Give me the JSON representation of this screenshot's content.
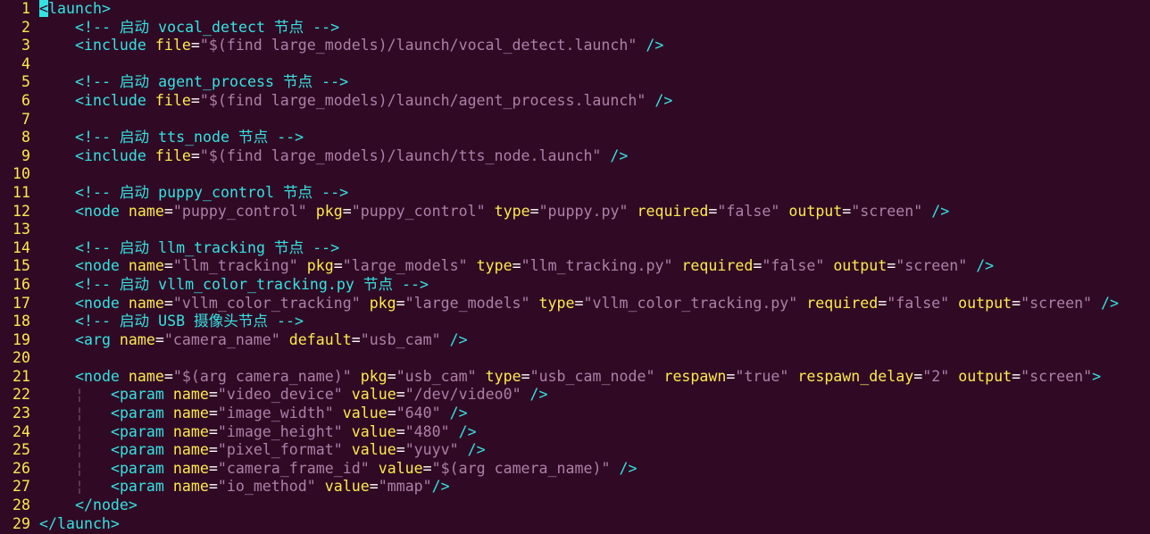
{
  "colors": {
    "background": "#300a24",
    "line_number": "#fce94f",
    "tag": "#34e2e2",
    "comment": "#34e2e2",
    "attribute": "#fce94f",
    "string": "#ad7fa8",
    "equals": "#ffffff",
    "cursor": "#34e2e2",
    "indent_guide": "#6a4a62"
  },
  "lines": [
    {
      "n": "1",
      "tokens": [
        {
          "t": "cursor",
          "v": "<"
        },
        {
          "t": "tag",
          "v": "launch>"
        }
      ]
    },
    {
      "n": "2",
      "tokens": [
        {
          "t": "ws",
          "v": "    "
        },
        {
          "t": "comment",
          "v": "<!-- 启动 vocal_detect 节点 -->"
        }
      ]
    },
    {
      "n": "3",
      "tokens": [
        {
          "t": "ws",
          "v": "    "
        },
        {
          "t": "tag",
          "v": "<include "
        },
        {
          "t": "attr",
          "v": "file"
        },
        {
          "t": "eq",
          "v": "="
        },
        {
          "t": "str",
          "v": "\"$(find large_models)/launch/vocal_detect.launch\""
        },
        {
          "t": "tag",
          "v": " />"
        }
      ]
    },
    {
      "n": "4",
      "tokens": []
    },
    {
      "n": "5",
      "tokens": [
        {
          "t": "ws",
          "v": "    "
        },
        {
          "t": "comment",
          "v": "<!-- 启动 agent_process 节点 -->"
        }
      ]
    },
    {
      "n": "6",
      "tokens": [
        {
          "t": "ws",
          "v": "    "
        },
        {
          "t": "tag",
          "v": "<include "
        },
        {
          "t": "attr",
          "v": "file"
        },
        {
          "t": "eq",
          "v": "="
        },
        {
          "t": "str",
          "v": "\"$(find large_models)/launch/agent_process.launch\""
        },
        {
          "t": "tag",
          "v": " />"
        }
      ]
    },
    {
      "n": "7",
      "tokens": []
    },
    {
      "n": "8",
      "tokens": [
        {
          "t": "ws",
          "v": "    "
        },
        {
          "t": "comment",
          "v": "<!-- 启动 tts_node 节点 -->"
        }
      ]
    },
    {
      "n": "9",
      "tokens": [
        {
          "t": "ws",
          "v": "    "
        },
        {
          "t": "tag",
          "v": "<include "
        },
        {
          "t": "attr",
          "v": "file"
        },
        {
          "t": "eq",
          "v": "="
        },
        {
          "t": "str",
          "v": "\"$(find large_models)/launch/tts_node.launch\""
        },
        {
          "t": "tag",
          "v": " />"
        }
      ]
    },
    {
      "n": "10",
      "tokens": []
    },
    {
      "n": "11",
      "tokens": [
        {
          "t": "ws",
          "v": "    "
        },
        {
          "t": "comment",
          "v": "<!-- 启动 puppy_control 节点 -->"
        }
      ]
    },
    {
      "n": "12",
      "tokens": [
        {
          "t": "ws",
          "v": "    "
        },
        {
          "t": "tag",
          "v": "<node "
        },
        {
          "t": "attr",
          "v": "name"
        },
        {
          "t": "eq",
          "v": "="
        },
        {
          "t": "str",
          "v": "\"puppy_control\""
        },
        {
          "t": "ws",
          "v": " "
        },
        {
          "t": "attr",
          "v": "pkg"
        },
        {
          "t": "eq",
          "v": "="
        },
        {
          "t": "str",
          "v": "\"puppy_control\""
        },
        {
          "t": "ws",
          "v": " "
        },
        {
          "t": "attr",
          "v": "type"
        },
        {
          "t": "eq",
          "v": "="
        },
        {
          "t": "str",
          "v": "\"puppy.py\""
        },
        {
          "t": "ws",
          "v": " "
        },
        {
          "t": "attr",
          "v": "required"
        },
        {
          "t": "eq",
          "v": "="
        },
        {
          "t": "str",
          "v": "\"false\""
        },
        {
          "t": "ws",
          "v": " "
        },
        {
          "t": "attr",
          "v": "output"
        },
        {
          "t": "eq",
          "v": "="
        },
        {
          "t": "str",
          "v": "\"screen\""
        },
        {
          "t": "tag",
          "v": " />"
        }
      ]
    },
    {
      "n": "13",
      "tokens": []
    },
    {
      "n": "14",
      "tokens": [
        {
          "t": "ws",
          "v": "    "
        },
        {
          "t": "comment",
          "v": "<!-- 启动 llm_tracking 节点 -->"
        }
      ]
    },
    {
      "n": "15",
      "tokens": [
        {
          "t": "ws",
          "v": "    "
        },
        {
          "t": "tag",
          "v": "<node "
        },
        {
          "t": "attr",
          "v": "name"
        },
        {
          "t": "eq",
          "v": "="
        },
        {
          "t": "str",
          "v": "\"llm_tracking\""
        },
        {
          "t": "ws",
          "v": " "
        },
        {
          "t": "attr",
          "v": "pkg"
        },
        {
          "t": "eq",
          "v": "="
        },
        {
          "t": "str",
          "v": "\"large_models\""
        },
        {
          "t": "ws",
          "v": " "
        },
        {
          "t": "attr",
          "v": "type"
        },
        {
          "t": "eq",
          "v": "="
        },
        {
          "t": "str",
          "v": "\"llm_tracking.py\""
        },
        {
          "t": "ws",
          "v": " "
        },
        {
          "t": "attr",
          "v": "required"
        },
        {
          "t": "eq",
          "v": "="
        },
        {
          "t": "str",
          "v": "\"false\""
        },
        {
          "t": "ws",
          "v": " "
        },
        {
          "t": "attr",
          "v": "output"
        },
        {
          "t": "eq",
          "v": "="
        },
        {
          "t": "str",
          "v": "\"screen\""
        },
        {
          "t": "tag",
          "v": " />"
        }
      ]
    },
    {
      "n": "16",
      "tokens": [
        {
          "t": "ws",
          "v": "    "
        },
        {
          "t": "comment",
          "v": "<!-- 启动 vllm_color_tracking.py 节点 -->"
        }
      ]
    },
    {
      "n": "17",
      "tokens": [
        {
          "t": "ws",
          "v": "    "
        },
        {
          "t": "tag",
          "v": "<node "
        },
        {
          "t": "attr",
          "v": "name"
        },
        {
          "t": "eq",
          "v": "="
        },
        {
          "t": "str",
          "v": "\"vllm_color_tracking\""
        },
        {
          "t": "ws",
          "v": " "
        },
        {
          "t": "attr",
          "v": "pkg"
        },
        {
          "t": "eq",
          "v": "="
        },
        {
          "t": "str",
          "v": "\"large_models\""
        },
        {
          "t": "ws",
          "v": " "
        },
        {
          "t": "attr",
          "v": "type"
        },
        {
          "t": "eq",
          "v": "="
        },
        {
          "t": "str",
          "v": "\"vllm_color_tracking.py\""
        },
        {
          "t": "ws",
          "v": " "
        },
        {
          "t": "attr",
          "v": "required"
        },
        {
          "t": "eq",
          "v": "="
        },
        {
          "t": "str",
          "v": "\"false\""
        },
        {
          "t": "ws",
          "v": " "
        },
        {
          "t": "attr",
          "v": "output"
        },
        {
          "t": "eq",
          "v": "="
        },
        {
          "t": "str",
          "v": "\"screen\""
        },
        {
          "t": "tag",
          "v": " />"
        }
      ]
    },
    {
      "n": "18",
      "tokens": [
        {
          "t": "ws",
          "v": "    "
        },
        {
          "t": "comment",
          "v": "<!-- 启动 USB 摄像头节点 -->"
        }
      ]
    },
    {
      "n": "19",
      "tokens": [
        {
          "t": "ws",
          "v": "    "
        },
        {
          "t": "tag",
          "v": "<arg "
        },
        {
          "t": "attr",
          "v": "name"
        },
        {
          "t": "eq",
          "v": "="
        },
        {
          "t": "str",
          "v": "\"camera_name\""
        },
        {
          "t": "ws",
          "v": " "
        },
        {
          "t": "attr",
          "v": "default"
        },
        {
          "t": "eq",
          "v": "="
        },
        {
          "t": "str",
          "v": "\"usb_cam\""
        },
        {
          "t": "tag",
          "v": " />"
        }
      ]
    },
    {
      "n": "20",
      "tokens": []
    },
    {
      "n": "21",
      "tokens": [
        {
          "t": "ws",
          "v": "    "
        },
        {
          "t": "tag",
          "v": "<node "
        },
        {
          "t": "attr",
          "v": "name"
        },
        {
          "t": "eq",
          "v": "="
        },
        {
          "t": "str",
          "v": "\"$(arg camera_name)\""
        },
        {
          "t": "ws",
          "v": " "
        },
        {
          "t": "attr",
          "v": "pkg"
        },
        {
          "t": "eq",
          "v": "="
        },
        {
          "t": "str",
          "v": "\"usb_cam\""
        },
        {
          "t": "ws",
          "v": " "
        },
        {
          "t": "attr",
          "v": "type"
        },
        {
          "t": "eq",
          "v": "="
        },
        {
          "t": "str",
          "v": "\"usb_cam_node\""
        },
        {
          "t": "ws",
          "v": " "
        },
        {
          "t": "attr",
          "v": "respawn"
        },
        {
          "t": "eq",
          "v": "="
        },
        {
          "t": "str",
          "v": "\"true\""
        },
        {
          "t": "ws",
          "v": " "
        },
        {
          "t": "attr",
          "v": "respawn_delay"
        },
        {
          "t": "eq",
          "v": "="
        },
        {
          "t": "str",
          "v": "\"2\""
        },
        {
          "t": "ws",
          "v": " "
        },
        {
          "t": "attr",
          "v": "output"
        },
        {
          "t": "eq",
          "v": "="
        },
        {
          "t": "str",
          "v": "\"screen\""
        },
        {
          "t": "tag",
          "v": ">"
        }
      ]
    },
    {
      "n": "22",
      "tokens": [
        {
          "t": "ws",
          "v": "    "
        },
        {
          "t": "guide",
          "v": "¦"
        },
        {
          "t": "ws",
          "v": "   "
        },
        {
          "t": "tag",
          "v": "<param "
        },
        {
          "t": "attr",
          "v": "name"
        },
        {
          "t": "eq",
          "v": "="
        },
        {
          "t": "str",
          "v": "\"video_device\""
        },
        {
          "t": "ws",
          "v": " "
        },
        {
          "t": "attr",
          "v": "value"
        },
        {
          "t": "eq",
          "v": "="
        },
        {
          "t": "str",
          "v": "\"/dev/video0\""
        },
        {
          "t": "tag",
          "v": " />"
        }
      ]
    },
    {
      "n": "23",
      "tokens": [
        {
          "t": "ws",
          "v": "    "
        },
        {
          "t": "guide",
          "v": "¦"
        },
        {
          "t": "ws",
          "v": "   "
        },
        {
          "t": "tag",
          "v": "<param "
        },
        {
          "t": "attr",
          "v": "name"
        },
        {
          "t": "eq",
          "v": "="
        },
        {
          "t": "str",
          "v": "\"image_width\""
        },
        {
          "t": "ws",
          "v": " "
        },
        {
          "t": "attr",
          "v": "value"
        },
        {
          "t": "eq",
          "v": "="
        },
        {
          "t": "str",
          "v": "\"640\""
        },
        {
          "t": "tag",
          "v": " />"
        }
      ]
    },
    {
      "n": "24",
      "tokens": [
        {
          "t": "ws",
          "v": "    "
        },
        {
          "t": "guide",
          "v": "¦"
        },
        {
          "t": "ws",
          "v": "   "
        },
        {
          "t": "tag",
          "v": "<param "
        },
        {
          "t": "attr",
          "v": "name"
        },
        {
          "t": "eq",
          "v": "="
        },
        {
          "t": "str",
          "v": "\"image_height\""
        },
        {
          "t": "ws",
          "v": " "
        },
        {
          "t": "attr",
          "v": "value"
        },
        {
          "t": "eq",
          "v": "="
        },
        {
          "t": "str",
          "v": "\"480\""
        },
        {
          "t": "tag",
          "v": " />"
        }
      ]
    },
    {
      "n": "25",
      "tokens": [
        {
          "t": "ws",
          "v": "    "
        },
        {
          "t": "guide",
          "v": "¦"
        },
        {
          "t": "ws",
          "v": "   "
        },
        {
          "t": "tag",
          "v": "<param "
        },
        {
          "t": "attr",
          "v": "name"
        },
        {
          "t": "eq",
          "v": "="
        },
        {
          "t": "str",
          "v": "\"pixel_format\""
        },
        {
          "t": "ws",
          "v": " "
        },
        {
          "t": "attr",
          "v": "value"
        },
        {
          "t": "eq",
          "v": "="
        },
        {
          "t": "str",
          "v": "\"yuyv\""
        },
        {
          "t": "tag",
          "v": " />"
        }
      ]
    },
    {
      "n": "26",
      "tokens": [
        {
          "t": "ws",
          "v": "    "
        },
        {
          "t": "guide",
          "v": "¦"
        },
        {
          "t": "ws",
          "v": "   "
        },
        {
          "t": "tag",
          "v": "<param "
        },
        {
          "t": "attr",
          "v": "name"
        },
        {
          "t": "eq",
          "v": "="
        },
        {
          "t": "str",
          "v": "\"camera_frame_id\""
        },
        {
          "t": "ws",
          "v": " "
        },
        {
          "t": "attr",
          "v": "value"
        },
        {
          "t": "eq",
          "v": "="
        },
        {
          "t": "str",
          "v": "\"$(arg camera_name)\""
        },
        {
          "t": "tag",
          "v": " />"
        }
      ]
    },
    {
      "n": "27",
      "tokens": [
        {
          "t": "ws",
          "v": "    "
        },
        {
          "t": "guide",
          "v": "¦"
        },
        {
          "t": "ws",
          "v": "   "
        },
        {
          "t": "tag",
          "v": "<param "
        },
        {
          "t": "attr",
          "v": "name"
        },
        {
          "t": "eq",
          "v": "="
        },
        {
          "t": "str",
          "v": "\"io_method\""
        },
        {
          "t": "ws",
          "v": " "
        },
        {
          "t": "attr",
          "v": "value"
        },
        {
          "t": "eq",
          "v": "="
        },
        {
          "t": "str",
          "v": "\"mmap\""
        },
        {
          "t": "tag",
          "v": "/>"
        }
      ]
    },
    {
      "n": "28",
      "tokens": [
        {
          "t": "ws",
          "v": "    "
        },
        {
          "t": "tag",
          "v": "</node>"
        }
      ]
    },
    {
      "n": "29",
      "tokens": [
        {
          "t": "tag",
          "v": "</launch>"
        }
      ]
    }
  ]
}
